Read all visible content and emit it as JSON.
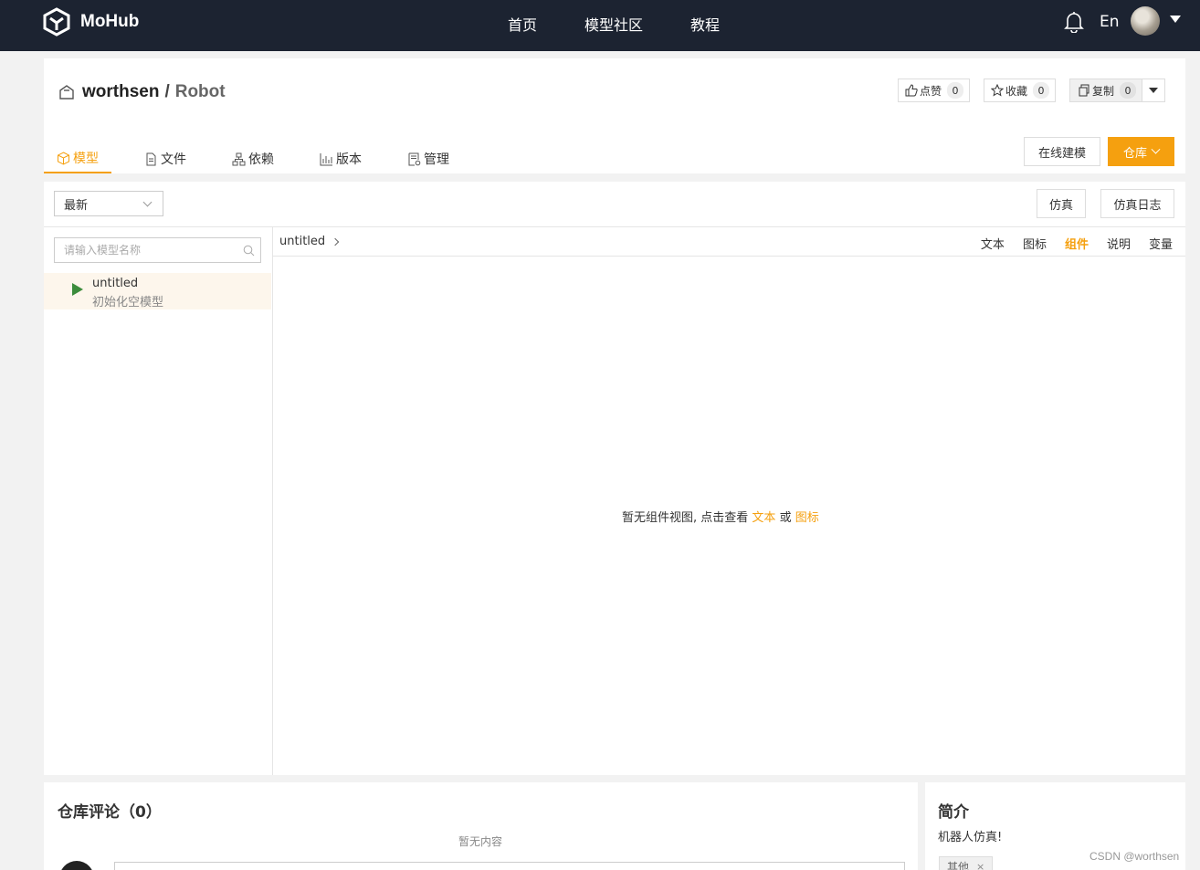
{
  "topbar": {
    "logo_text": "MoHub",
    "nav": [
      "首页",
      "模型社区",
      "教程"
    ],
    "lang": "En"
  },
  "repo": {
    "owner": "worthsen",
    "separator": "/",
    "name": "Robot",
    "like_label": "点赞",
    "like_count": "0",
    "star_label": "收藏",
    "star_count": "0",
    "fork_label": "复制",
    "fork_count": "0",
    "tabs": [
      "模型",
      "文件",
      "依赖",
      "版本",
      "管理"
    ],
    "online_btn": "在线建模",
    "repo_btn": "仓库"
  },
  "model": {
    "sort_select": "最新",
    "sim_btn": "仿真",
    "sim_log_btn": "仿真日志",
    "search_placeholder": "请输入模型名称",
    "items": [
      {
        "name": "untitled",
        "desc": "初始化空模型"
      }
    ],
    "breadcrumb": "untitled",
    "view_tabs": [
      "文本",
      "图标",
      "组件",
      "说明",
      "变量"
    ],
    "active_view": "组件",
    "empty_prefix": "暂无组件视图, 点击查看",
    "empty_link1": "文本",
    "empty_or": "或",
    "empty_link2": "图标"
  },
  "comments": {
    "title": "仓库评论（0）",
    "empty": "暂无内容"
  },
  "intro": {
    "title": "简介",
    "text": "机器人仿真!",
    "tag": "其他"
  },
  "watermark": "CSDN @worthsen",
  "colors": {
    "accent": "#f5a00f",
    "topbar": "#1c2331"
  }
}
